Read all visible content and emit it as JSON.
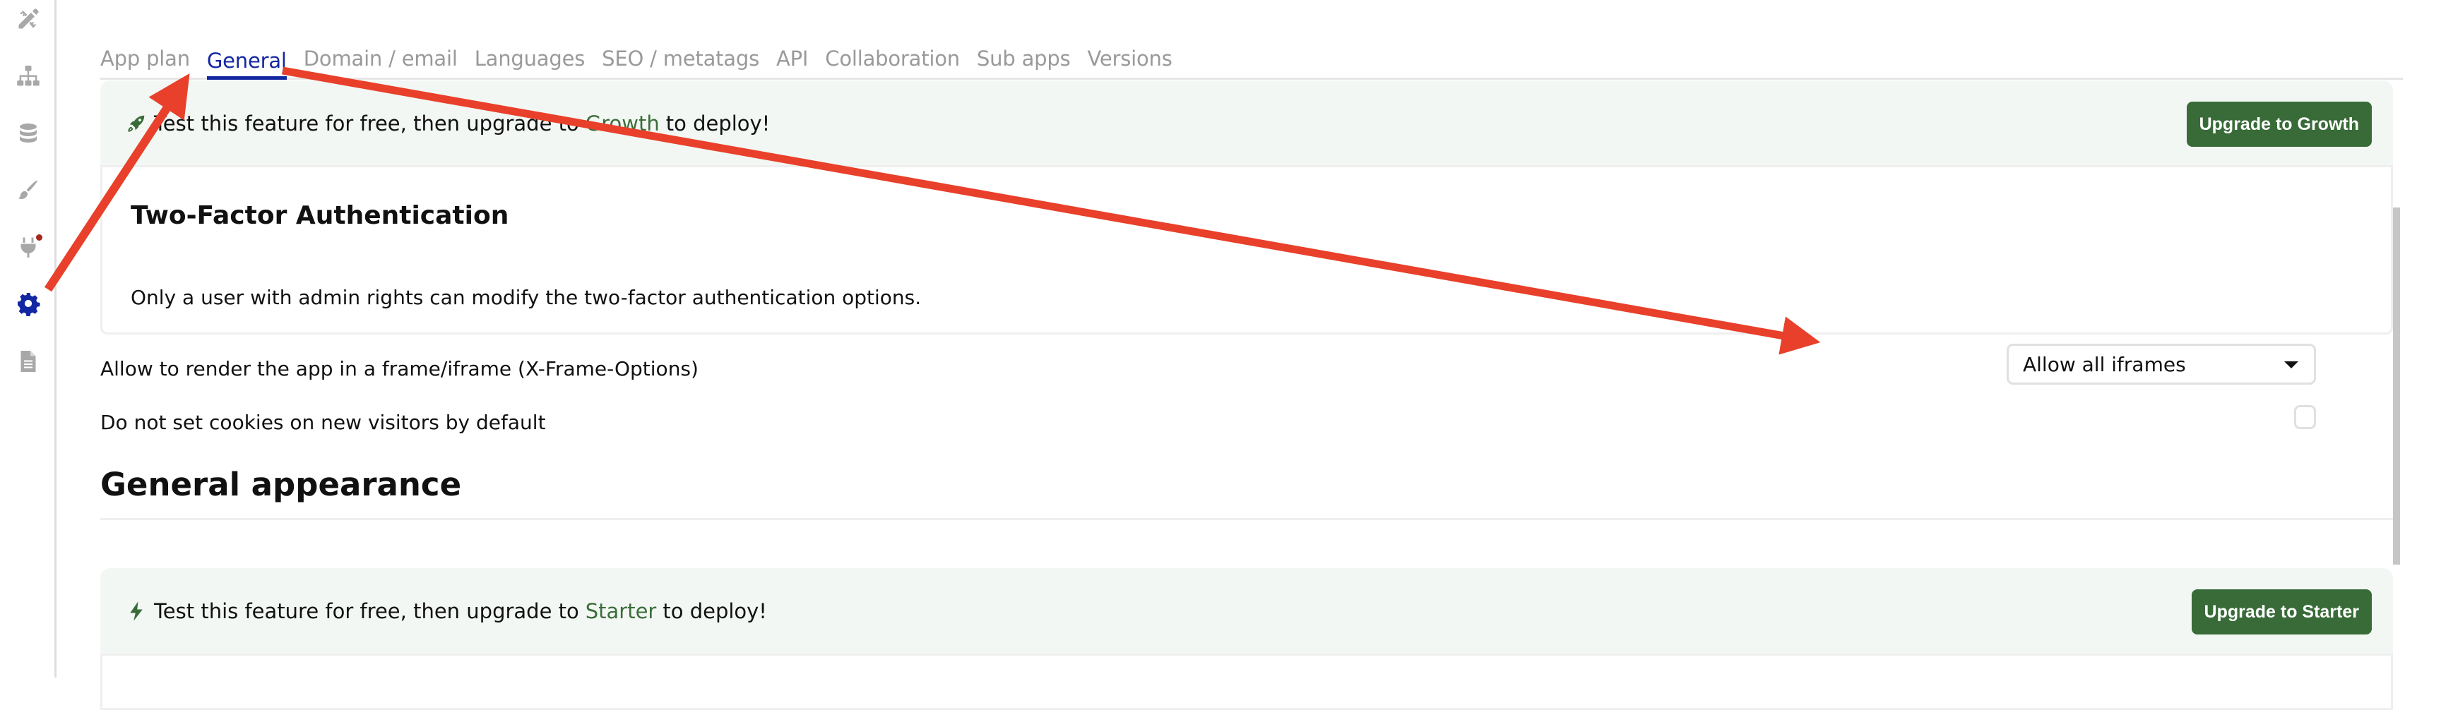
{
  "sidebar": {
    "items": [
      {
        "name": "design",
        "icon": "pencil-ruler-icon",
        "active": false
      },
      {
        "name": "workflow",
        "icon": "sitemap-icon",
        "active": false
      },
      {
        "name": "data",
        "icon": "database-icon",
        "active": false
      },
      {
        "name": "styles",
        "icon": "paintbrush-icon",
        "active": false
      },
      {
        "name": "plugins",
        "icon": "plug-icon",
        "active": false,
        "notification": true
      },
      {
        "name": "settings",
        "icon": "gear-icon",
        "active": true
      },
      {
        "name": "logs",
        "icon": "document-icon",
        "active": false
      }
    ],
    "active_color": "#1427a2",
    "inactive_color": "#a8a8a8",
    "notification_color": "#a5281b"
  },
  "tabs": [
    {
      "label": "App plan",
      "active": false
    },
    {
      "label": "General",
      "active": true
    },
    {
      "label": "Domain / email",
      "active": false
    },
    {
      "label": "Languages",
      "active": false
    },
    {
      "label": "SEO / metatags",
      "active": false
    },
    {
      "label": "API",
      "active": false
    },
    {
      "label": "Collaboration",
      "active": false
    },
    {
      "label": "Sub apps",
      "active": false
    },
    {
      "label": "Versions",
      "active": false
    }
  ],
  "growth_banner": {
    "icon": "rocket-icon",
    "text_before": "Test this feature for free, then upgrade to",
    "plan_name": "Growth",
    "text_after": "to deploy!",
    "button_label": "Upgrade to Growth"
  },
  "two_factor": {
    "title": "Two-Factor Authentication",
    "description": "Only a user with admin rights can modify the two-factor authentication options."
  },
  "settings": {
    "iframe_label": "Allow to render the app in a frame/iframe (X-Frame-Options)",
    "iframe_value": "Allow all iframes",
    "cookies_label": "Do not set cookies on new visitors by default",
    "cookies_checked": false
  },
  "general_appearance": {
    "title": "General appearance"
  },
  "starter_banner": {
    "icon": "lightning-bolt-icon",
    "text_before": "Test this feature for free, then upgrade to",
    "plan_name": "Starter",
    "text_after": "to deploy!",
    "button_label": "Upgrade to Starter"
  },
  "colors": {
    "brand_green": "#386b38",
    "accent_blue": "#1427a2",
    "annotation_red": "#e8402a",
    "banner_bg": "#f3f7f4"
  },
  "annotations": [
    {
      "type": "arrow",
      "from": "settings-gear",
      "to": "tab-general"
    },
    {
      "type": "arrow",
      "from": "tab-general",
      "to": "iframe-dropdown"
    }
  ]
}
